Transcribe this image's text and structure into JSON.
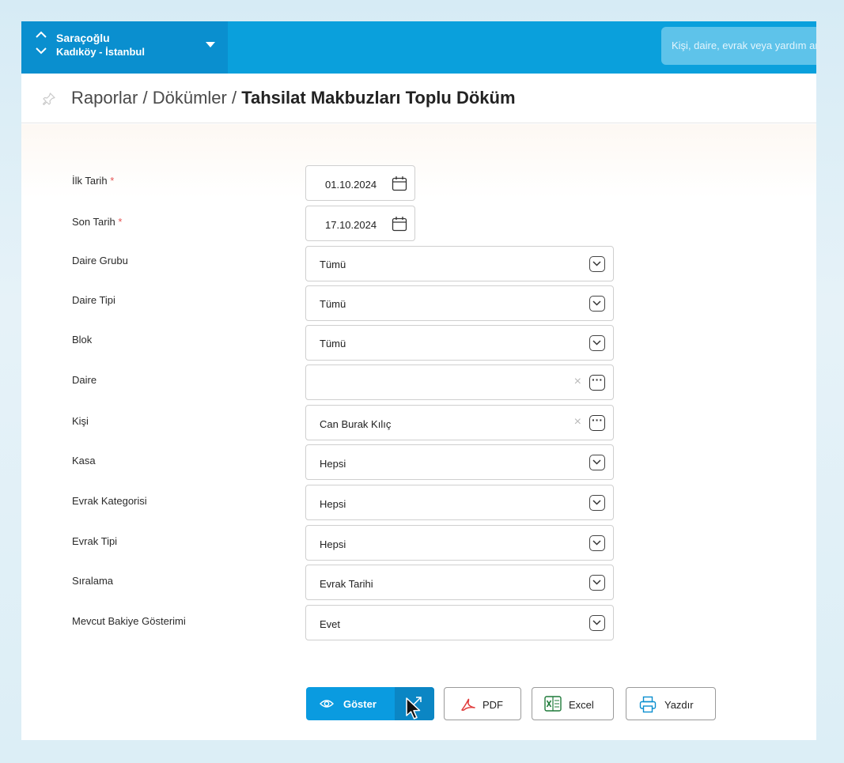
{
  "header": {
    "site_name": "Saraçoğlu",
    "site_location": "Kadıköy - İstanbul",
    "search_placeholder": "Kişi, daire, evrak veya yardım ara"
  },
  "breadcrumb": {
    "part1": "Raporlar",
    "sep1": " / ",
    "part2": "Dökümler",
    "sep2": " / ",
    "current": "Tahsilat Makbuzları Toplu Döküm"
  },
  "form": {
    "required_mark": "*",
    "ilk_tarih": {
      "label": "İlk Tarih",
      "value": "01.10.2024"
    },
    "son_tarih": {
      "label": "Son Tarih",
      "value": "17.10.2024"
    },
    "daire_grubu": {
      "label": "Daire Grubu",
      "value": "Tümü"
    },
    "daire_tipi": {
      "label": "Daire Tipi",
      "value": "Tümü"
    },
    "blok": {
      "label": "Blok",
      "value": "Tümü"
    },
    "daire": {
      "label": "Daire",
      "value": ""
    },
    "kisi": {
      "label": "Kişi",
      "value": "Can Burak Kılıç"
    },
    "kasa": {
      "label": "Kasa",
      "value": "Hepsi"
    },
    "evrak_kategorisi": {
      "label": "Evrak Kategorisi",
      "value": "Hepsi"
    },
    "evrak_tipi": {
      "label": "Evrak Tipi",
      "value": "Hepsi"
    },
    "siralama": {
      "label": "Sıralama",
      "value": "Evrak Tarihi"
    },
    "mevcut_bakiye": {
      "label": "Mevcut Bakiye Gösterimi",
      "value": "Evet"
    }
  },
  "actions": {
    "show": "Göster",
    "pdf": "PDF",
    "excel": "Excel",
    "print": "Yazdır"
  },
  "colors": {
    "topbar": "#0aa0dc",
    "switcher": "#0a8fcf",
    "primary_button": "#0a9be0",
    "required": "#e55353",
    "pdf_icon": "#e03a3a",
    "excel_icon": "#1f7a3a",
    "print_icon": "#0a8fcf"
  }
}
